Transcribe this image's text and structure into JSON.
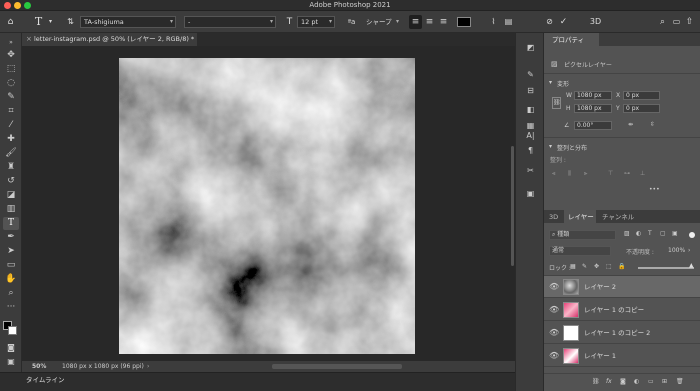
{
  "window": {
    "title": "Adobe Photoshop 2021"
  },
  "options_bar": {
    "font_family": "TA-shigiuma",
    "font_style": "-",
    "font_size": "12 pt",
    "aa_mode": "シャープ",
    "tool_glyph": "T"
  },
  "document": {
    "tab_title": "letter-instagram.psd @ 50% (レイヤー 2, RGB/8) *",
    "zoom": "50%",
    "info": "1080 px x 1080 px (96 ppi)"
  },
  "timeline": {
    "label": "タイムライン"
  },
  "properties": {
    "tab": "プロパティ",
    "kind": "ピクセルレイヤー",
    "transform_title": "変形",
    "w_label": "W",
    "w_value": "1080 px",
    "h_label": "H",
    "h_value": "1080 px",
    "x_label": "X",
    "x_value": "0 px",
    "y_label": "Y",
    "y_value": "0 px",
    "angle": "0.00°",
    "align_title": "整列と分布",
    "align_sub": "整列 :",
    "more": "•••"
  },
  "layers_panel": {
    "tabs": [
      "3D",
      "レイヤー",
      "チャンネル"
    ],
    "filter": "種類",
    "blend_mode": "通常",
    "opacity_label": "不透明度 :",
    "opacity_value": "100%",
    "lock_label": "ロック :",
    "layers": [
      {
        "name": "レイヤー 2",
        "selected": true
      },
      {
        "name": "レイヤー 1 のコピー",
        "selected": false
      },
      {
        "name": "レイヤー 1 のコピー 2",
        "selected": false
      },
      {
        "name": "レイヤー 1",
        "selected": false
      }
    ],
    "footer": {
      "fx": "fx"
    }
  },
  "colors": {
    "accent": "#3b7bd6",
    "panel": "#535353",
    "dark": "#3c3c3c"
  }
}
